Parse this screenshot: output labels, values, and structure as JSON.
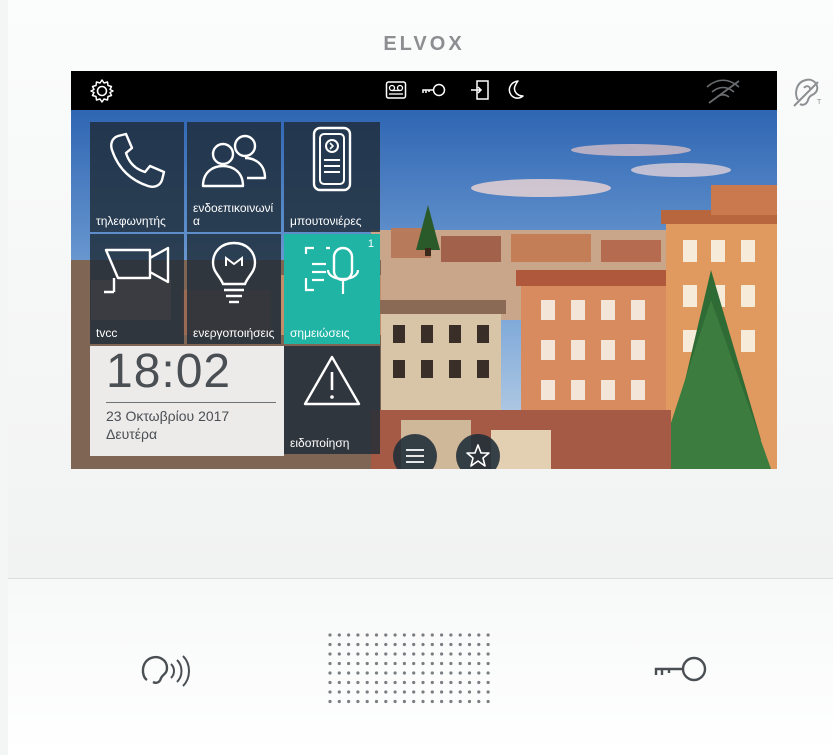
{
  "device": {
    "brand": "ELVOX"
  },
  "statusbar": {
    "icons": [
      "gear-icon",
      "answering-machine-icon",
      "key-icon",
      "door-exit-icon",
      "moon-icon",
      "wifi-off-icon"
    ]
  },
  "tiles": [
    {
      "label": "τηλεφωνητής",
      "icon": "phone-icon"
    },
    {
      "label": "ενδοεπικοινωνία",
      "icon": "users-icon"
    },
    {
      "label": "μπουτονιέρες",
      "icon": "door-panel-icon"
    },
    {
      "label": "tvcc",
      "icon": "cctv-icon"
    },
    {
      "label": "ενεργοποιήσεις",
      "icon": "lightbulb-icon"
    },
    {
      "label": "σημειώσεις",
      "icon": "voice-memo-icon",
      "badge": "1"
    },
    {
      "label": "ειδοποίηση",
      "icon": "warning-icon"
    }
  ],
  "clock": {
    "time": "18:02",
    "date": "23 Οκτωβρίου 2017",
    "day": "Δευτέρα"
  },
  "bottom_buttons": [
    "list-icon",
    "favorites-icon"
  ],
  "hardware": [
    "talk-button-icon",
    "door-key-button-icon"
  ],
  "colors": {
    "tile_bg": "#1e2c38",
    "tile_active": "#20b4a5",
    "screen_bezel": "#000000"
  }
}
